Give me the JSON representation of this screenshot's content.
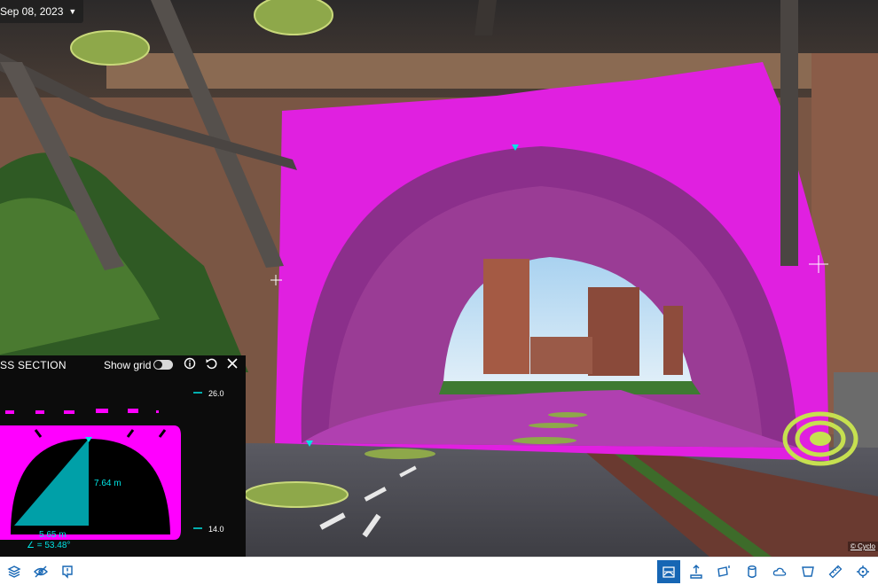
{
  "viewer": {
    "date_label": "Sep 08, 2023",
    "copyright": "© Cyclo"
  },
  "cross_section": {
    "title": "SS SECTION",
    "show_grid_label": "Show grid",
    "show_grid_on": false,
    "height_label": "7.64 m",
    "width_label": "5.65 m",
    "angle_label": "∠ = 53.48°",
    "scale_top": "26.0",
    "scale_bottom": "14.0",
    "accent_color": "#00e5e5",
    "profile_color": "#ff00ff"
  },
  "toolbar": {
    "left": [
      {
        "name": "layers-button",
        "icon": "layers-icon"
      },
      {
        "name": "hide-button",
        "icon": "eye-off-icon"
      },
      {
        "name": "report-button",
        "icon": "report-icon"
      }
    ],
    "right": [
      {
        "name": "cross-section-button",
        "icon": "cross-section-icon",
        "active": true
      },
      {
        "name": "height-button",
        "icon": "height-icon"
      },
      {
        "name": "area-button",
        "icon": "area-icon"
      },
      {
        "name": "volume-button",
        "icon": "cylinder-icon"
      },
      {
        "name": "point-cloud-button",
        "icon": "cloud-icon"
      },
      {
        "name": "facade-button",
        "icon": "facade-icon"
      },
      {
        "name": "measure-button",
        "icon": "ruler-icon"
      },
      {
        "name": "locate-button",
        "icon": "crosshair-icon"
      }
    ]
  }
}
